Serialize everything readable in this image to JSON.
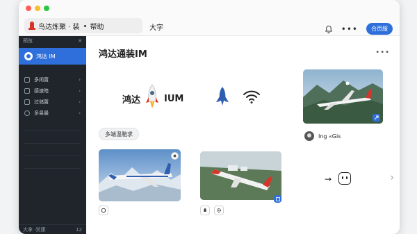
{
  "window": {
    "tab_active_label": "鸟达炼聚 · 装",
    "tab_active_suffix": "帮助",
    "tab_second": "大字",
    "primary_button": "合页服"
  },
  "sidebar": {
    "header_label": "预览",
    "user_label": "鸿达 IM",
    "items": [
      {
        "label": "多闲置",
        "icon": "shield-icon"
      },
      {
        "label": "感速暗",
        "icon": "image-icon"
      },
      {
        "label": "过储置",
        "icon": "folder-icon"
      },
      {
        "label": "多易最",
        "icon": "wifi-icon"
      }
    ],
    "footer_label": "大拿 ·贸康",
    "footer_right": "12"
  },
  "main": {
    "title": "鸿达通装IM",
    "hero_text_left": "鸿达",
    "hero_text_right": "IUM",
    "chip_label": "多端温馳求",
    "profile_label": "Ing «Gis"
  },
  "colors": {
    "accent": "#2f6fdb",
    "sidebar_bg": "#20252c",
    "logo_red": "#d8342a"
  }
}
